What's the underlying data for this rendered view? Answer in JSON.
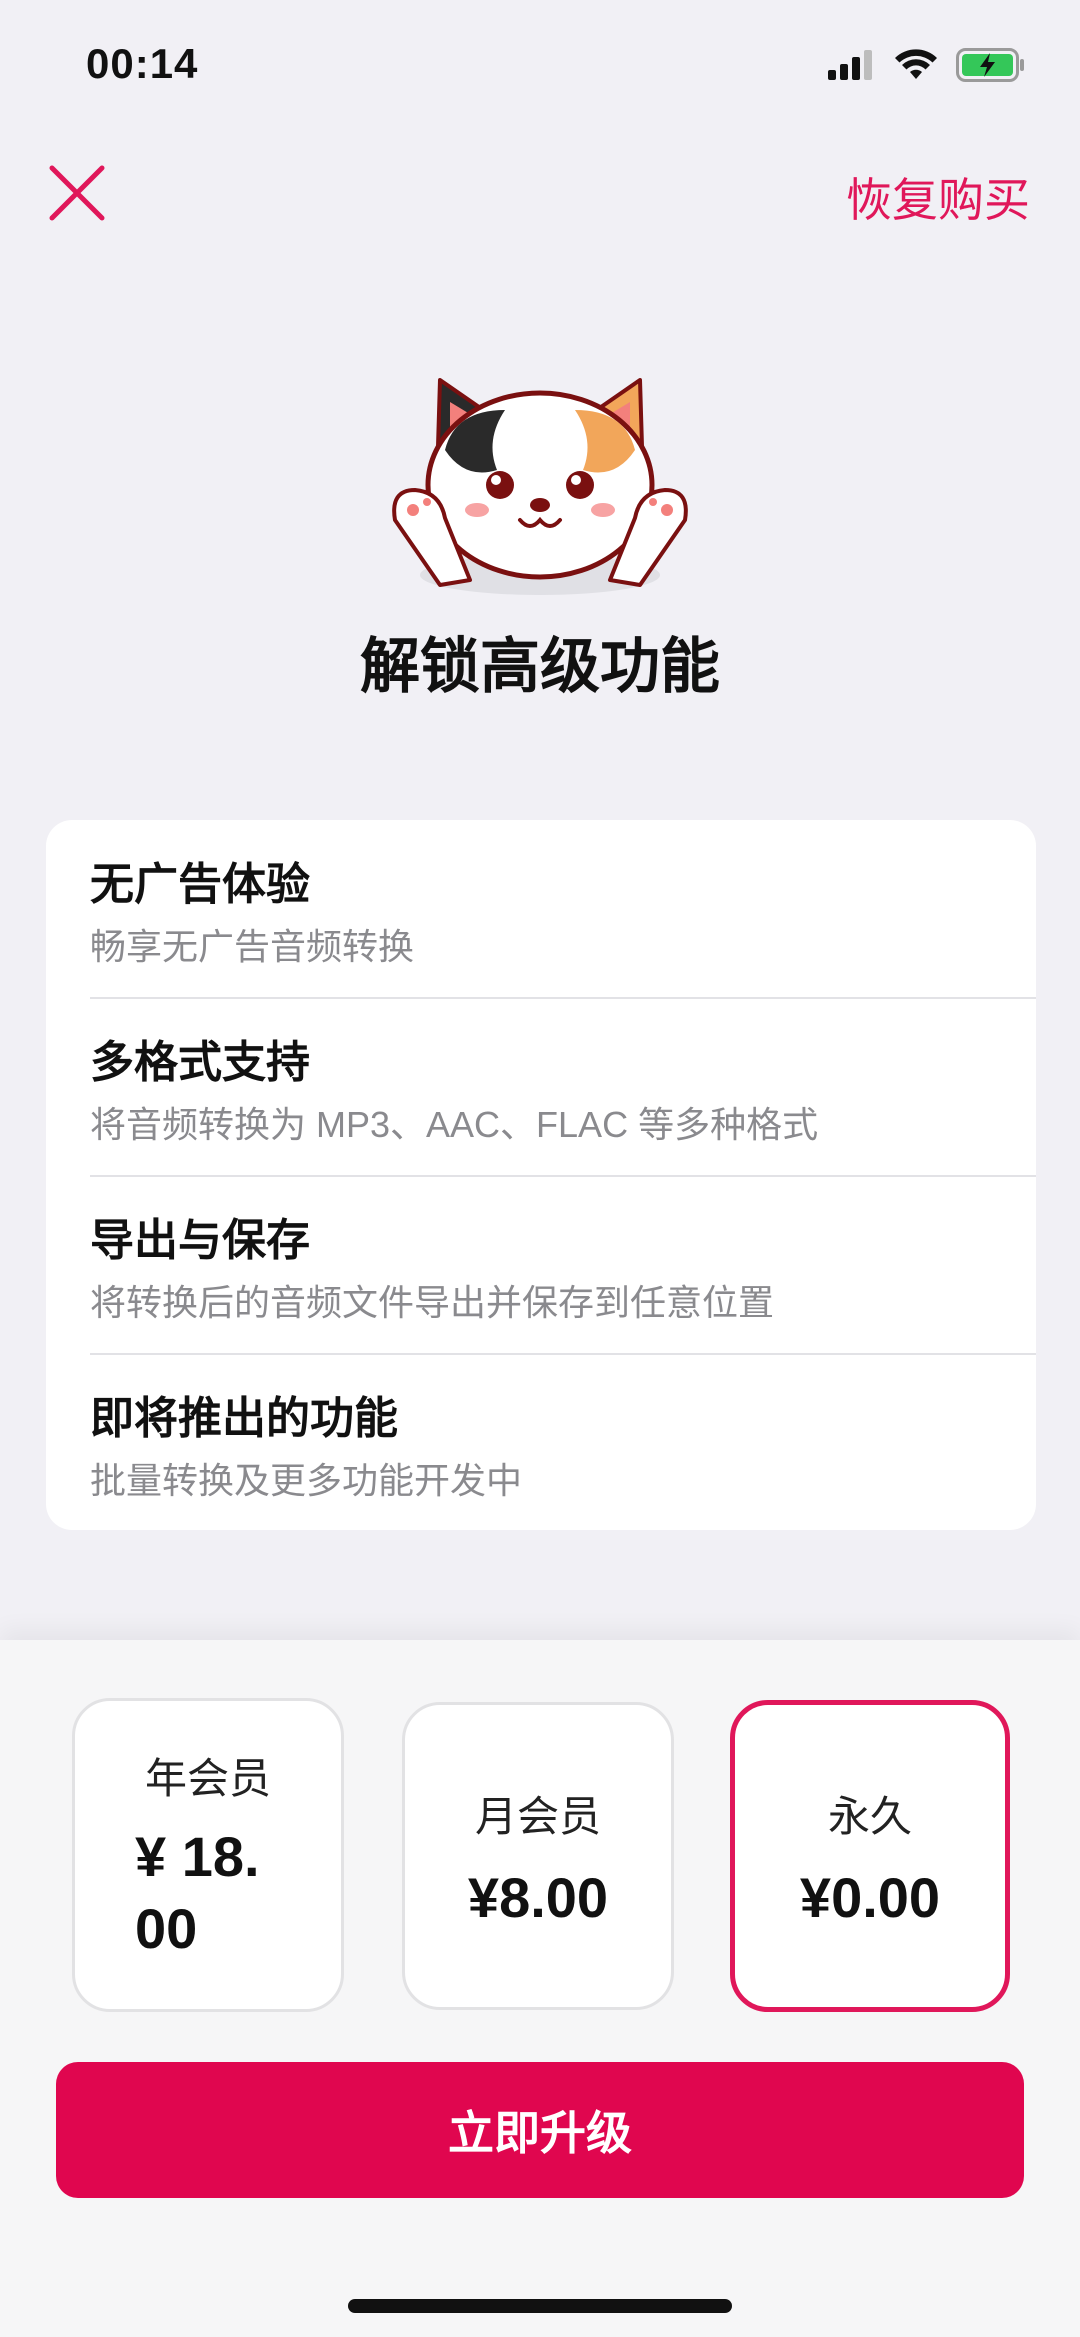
{
  "status_bar": {
    "time": "00:14"
  },
  "nav": {
    "restore_label": "恢复购买"
  },
  "hero": {
    "title": "解锁高级功能"
  },
  "features": [
    {
      "title": "无广告体验",
      "subtitle": "畅享无广告音频转换"
    },
    {
      "title": "多格式支持",
      "subtitle": "将音频转换为 MP3、AAC、FLAC 等多种格式"
    },
    {
      "title": "导出与保存",
      "subtitle": "将转换后的音频文件导出并保存到任意位置"
    },
    {
      "title": "即将推出的功能",
      "subtitle": "批量转换及更多功能开发中"
    }
  ],
  "plans": [
    {
      "name": "年会员",
      "price": "¥ 18.00",
      "selected": false
    },
    {
      "name": "月会员",
      "price": "¥8.00",
      "selected": false
    },
    {
      "name": "永久",
      "price": "¥0.00",
      "selected": true
    }
  ],
  "cta": {
    "label": "立即升级"
  },
  "colors": {
    "accent": "#e0175a",
    "button": "#e0064f",
    "background": "#f1f0f5"
  }
}
